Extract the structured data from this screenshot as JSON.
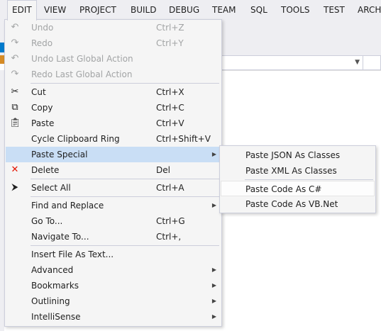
{
  "menubar": {
    "items": [
      "EDIT",
      "VIEW",
      "PROJECT",
      "BUILD",
      "DEBUG",
      "TEAM",
      "SQL",
      "TOOLS",
      "TEST",
      "ARCH"
    ]
  },
  "edit_menu": {
    "undo": {
      "label": "Undo",
      "shortcut": "Ctrl+Z",
      "icon": "undo-icon"
    },
    "redo": {
      "label": "Redo",
      "shortcut": "Ctrl+Y",
      "icon": "redo-icon"
    },
    "undo_global": {
      "label": "Undo Last Global Action",
      "icon": "undo-icon"
    },
    "redo_global": {
      "label": "Redo Last Global Action",
      "icon": "redo-icon"
    },
    "cut": {
      "label": "Cut",
      "shortcut": "Ctrl+X",
      "icon": "scissors-icon"
    },
    "copy": {
      "label": "Copy",
      "shortcut": "Ctrl+C",
      "icon": "copy-icon"
    },
    "paste": {
      "label": "Paste",
      "shortcut": "Ctrl+V",
      "icon": "clipboard-icon"
    },
    "cycle_clipboard": {
      "label": "Cycle Clipboard Ring",
      "shortcut": "Ctrl+Shift+V"
    },
    "paste_special": {
      "label": "Paste Special"
    },
    "delete": {
      "label": "Delete",
      "shortcut": "Del",
      "icon": "delete-x-icon"
    },
    "select_all": {
      "label": "Select All",
      "shortcut": "Ctrl+A",
      "icon": "select-all-icon"
    },
    "find_replace": {
      "label": "Find and Replace"
    },
    "go_to": {
      "label": "Go To...",
      "shortcut": "Ctrl+G"
    },
    "navigate_to": {
      "label": "Navigate To...",
      "shortcut": "Ctrl+,"
    },
    "insert_file": {
      "label": "Insert File As Text..."
    },
    "advanced": {
      "label": "Advanced"
    },
    "bookmarks": {
      "label": "Bookmarks"
    },
    "outlining": {
      "label": "Outlining"
    },
    "intellisense": {
      "label": "IntelliSense"
    }
  },
  "paste_special_menu": {
    "json": "Paste JSON As Classes",
    "xml": "Paste XML As Classes",
    "csharp": "Paste Code As C#",
    "vbnet": "Paste Code As VB.Net"
  },
  "colors": {
    "menubar_bg": "#eeeef2",
    "menu_bg": "#f5f5f5",
    "highlight": "#c9def5",
    "disabled_text": "#a2a4a5",
    "accent_blue": "#007acc",
    "delete_red": "#e51400"
  }
}
